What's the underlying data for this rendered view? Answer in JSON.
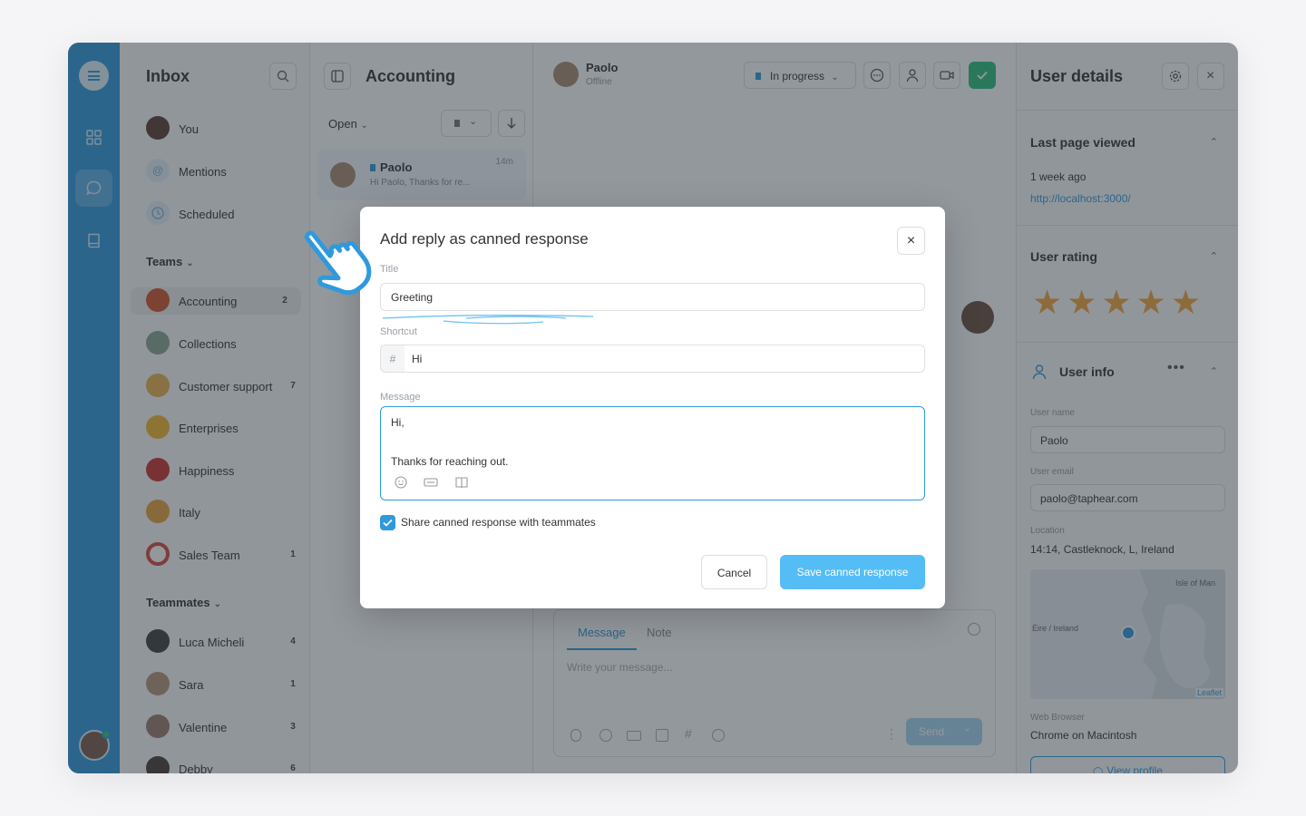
{
  "inbox": {
    "title": "Inbox",
    "items": [
      {
        "label": "You"
      },
      {
        "label": "Mentions"
      },
      {
        "label": "Scheduled"
      }
    ],
    "teams_header": "Teams",
    "teams": [
      {
        "label": "Accounting",
        "count": "2"
      },
      {
        "label": "Collections",
        "count": ""
      },
      {
        "label": "Customer support",
        "count": "7"
      },
      {
        "label": "Enterprises",
        "count": ""
      },
      {
        "label": "Happiness",
        "count": ""
      },
      {
        "label": "Italy",
        "count": ""
      },
      {
        "label": "Sales Team",
        "count": "1"
      }
    ],
    "teammates_header": "Teammates",
    "teammates": [
      {
        "label": "Luca Micheli",
        "count": "4"
      },
      {
        "label": "Sara",
        "count": "1"
      },
      {
        "label": "Valentine",
        "count": "3"
      },
      {
        "label": "Debby",
        "count": "6"
      }
    ]
  },
  "convlist": {
    "title": "Accounting",
    "filter": "Open",
    "card": {
      "name": "Paolo",
      "time": "14m",
      "preview": "Hi Paolo, Thanks for re..."
    }
  },
  "conversation": {
    "contact_name": "Paolo",
    "contact_status": "Offline",
    "status": "In progress",
    "composer": {
      "tab_message": "Message",
      "tab_note": "Note",
      "placeholder": "Write your message...",
      "send": "Send"
    }
  },
  "details": {
    "title": "User details",
    "last_page_header": "Last page viewed",
    "last_page_time": "1 week ago",
    "last_page_url": "http://localhost:3000/",
    "rating_header": "User rating",
    "rating": 5,
    "user_info_header": "User info",
    "user_name_label": "User name",
    "user_name": "Paolo",
    "user_email_label": "User email",
    "user_email": "paolo@taphear.com",
    "location_label": "Location",
    "location": "14:14, Castleknock, L, Ireland",
    "map_label_country": "Éire / Ireland",
    "map_label_isle": "Isle of Man",
    "map_attribution": "Leaflet",
    "browser_label": "Web Browser",
    "browser": "Chrome on Macintosh",
    "view_profile": "View profile"
  },
  "modal": {
    "title": "Add reply as canned response",
    "title_label": "Title",
    "title_value": "Greeting",
    "shortcut_label": "Shortcut",
    "shortcut_prefix": "#",
    "shortcut_value": "Hi",
    "message_label": "Message",
    "message_line1": "Hi,",
    "message_line2": "Thanks for reaching out.",
    "share_label": "Share canned response with teammates",
    "share_checked": true,
    "cancel": "Cancel",
    "save": "Save canned response"
  },
  "colors": {
    "accent": "#2f99dd",
    "resolve": "#2dbe7d",
    "star": "#f2a43a"
  }
}
